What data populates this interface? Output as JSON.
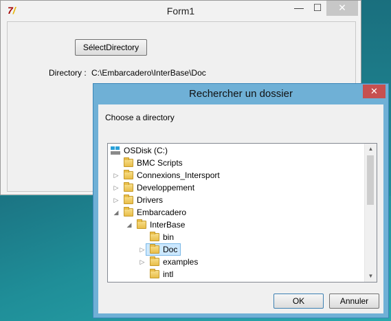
{
  "form1": {
    "title": "Form1",
    "icon": "delphi-app-icon",
    "min_symbol": "—",
    "max_symbol": "☐",
    "close_symbol": "✕",
    "select_button_label": "SélectDirectory",
    "directory_label": "Directory :",
    "directory_value": "C:\\Embarcadero\\InterBase\\Doc"
  },
  "dialog": {
    "title": "Rechercher un dossier",
    "close_symbol": "✕",
    "description": "Choose a directory",
    "tree": [
      {
        "label": "OSDisk (C:)",
        "icon": "drive-icon",
        "expander": ""
      },
      {
        "label": "BMC Scripts",
        "icon": "folder-icon",
        "expander": ""
      },
      {
        "label": "Connexions_Intersport",
        "icon": "folder-icon",
        "expander": "▷"
      },
      {
        "label": "Developpement",
        "icon": "folder-icon",
        "expander": "▷"
      },
      {
        "label": "Drivers",
        "icon": "folder-icon",
        "expander": "▷"
      },
      {
        "label": "Embarcadero",
        "icon": "folder-icon",
        "expander": "◢"
      },
      {
        "label": "InterBase",
        "icon": "folder-icon",
        "expander": "◢"
      },
      {
        "label": "bin",
        "icon": "folder-icon",
        "expander": ""
      },
      {
        "label": "Doc",
        "icon": "folder-icon",
        "expander": "▷",
        "selected": true
      },
      {
        "label": "examples",
        "icon": "folder-icon",
        "expander": "▷"
      },
      {
        "label": "intl",
        "icon": "folder-icon",
        "expander": ""
      }
    ],
    "scroll_up": "▲",
    "scroll_down": "▼",
    "ok_label": "OK",
    "cancel_label": "Annuler"
  },
  "colors": {
    "dialog_frame": "#6fb0d6",
    "close_red": "#c75050",
    "selection": "#cce8ff"
  }
}
